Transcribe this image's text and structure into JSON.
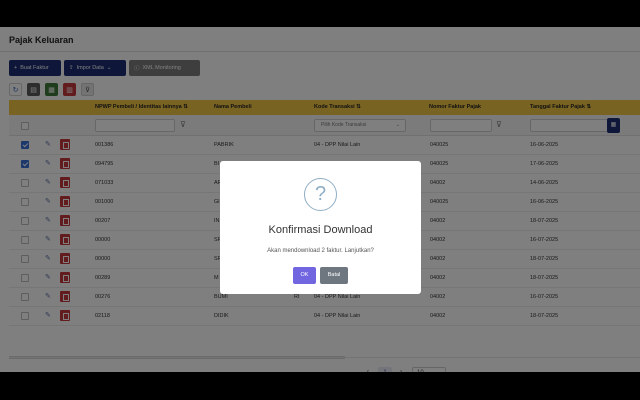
{
  "page": {
    "title": "Pajak Keluaran"
  },
  "toolbar": {
    "buat_faktur": "Buat Faktur",
    "impor_data": "Impor Data",
    "xml_monitoring": "XML Monitoring"
  },
  "table": {
    "headers": {
      "npwp": "NPWP Pembeli / Identitas lainnya",
      "nama": "Nama Pembeli",
      "kode": "Kode Transaksi",
      "nomor": "Nomor Faktur Pajak",
      "tanggal": "Tanggal Faktur Pajak"
    },
    "sort_icon": "⇅",
    "filter_placeholder": "Pilih Kode Transaksi",
    "rows": [
      {
        "checked": true,
        "npwp": "001386",
        "nama": "PABRIK",
        "nama2": "",
        "kode": "04 - DPP Nilai Lain",
        "nomor": "040025",
        "tanggal": "16-06-2025"
      },
      {
        "checked": true,
        "npwp": "094795",
        "nama": "BI",
        "nama2": "",
        "kode": "",
        "nomor": "040025",
        "tanggal": "17-06-2025"
      },
      {
        "checked": false,
        "npwp": "071033",
        "nama": "AF",
        "nama2": "",
        "kode": "",
        "nomor": "04002",
        "tanggal": "14-06-2025"
      },
      {
        "checked": false,
        "npwp": "001000",
        "nama": "Gl",
        "nama2": "",
        "kode": "",
        "nomor": "040025",
        "tanggal": "16-06-2025"
      },
      {
        "checked": false,
        "npwp": "00207",
        "nama": "IN",
        "nama2": "",
        "kode": "",
        "nomor": "04002",
        "tanggal": "18-07-2025"
      },
      {
        "checked": false,
        "npwp": "00000",
        "nama": "SF",
        "nama2": "",
        "kode": "",
        "nomor": "04002",
        "tanggal": "16-07-2025"
      },
      {
        "checked": false,
        "npwp": "00000",
        "nama": "SF",
        "nama2": "",
        "kode": "",
        "nomor": "04002",
        "tanggal": "18-07-2025"
      },
      {
        "checked": false,
        "npwp": "00289",
        "nama": "M",
        "nama2": "",
        "kode": "",
        "nomor": "04002",
        "tanggal": "18-07-2025"
      },
      {
        "checked": false,
        "npwp": "00276",
        "nama": "BUMI",
        "nama2": "RI",
        "kode": "04 - DPP Nilai Lain",
        "nomor": "04002",
        "tanggal": "16-07-2025"
      },
      {
        "checked": false,
        "npwp": "02118",
        "nama": "DIDIK",
        "nama2": "",
        "kode": "04 - DPP Nilai Lain",
        "nomor": "04002",
        "tanggal": "18-07-2025"
      }
    ]
  },
  "pagination": {
    "prev": "‹",
    "current": "1",
    "next": "›",
    "page_size": "10"
  },
  "modal": {
    "icon": "?",
    "title": "Konfirmasi Download",
    "message": "Akan mendownload 2 faktur. Lanjutkan?",
    "ok": "OK",
    "cancel": "Batal"
  },
  "colors": {
    "accent": "#7166e0",
    "header": "#f2c744",
    "navy": "#1c2f73",
    "pdf": "#c6383a"
  }
}
